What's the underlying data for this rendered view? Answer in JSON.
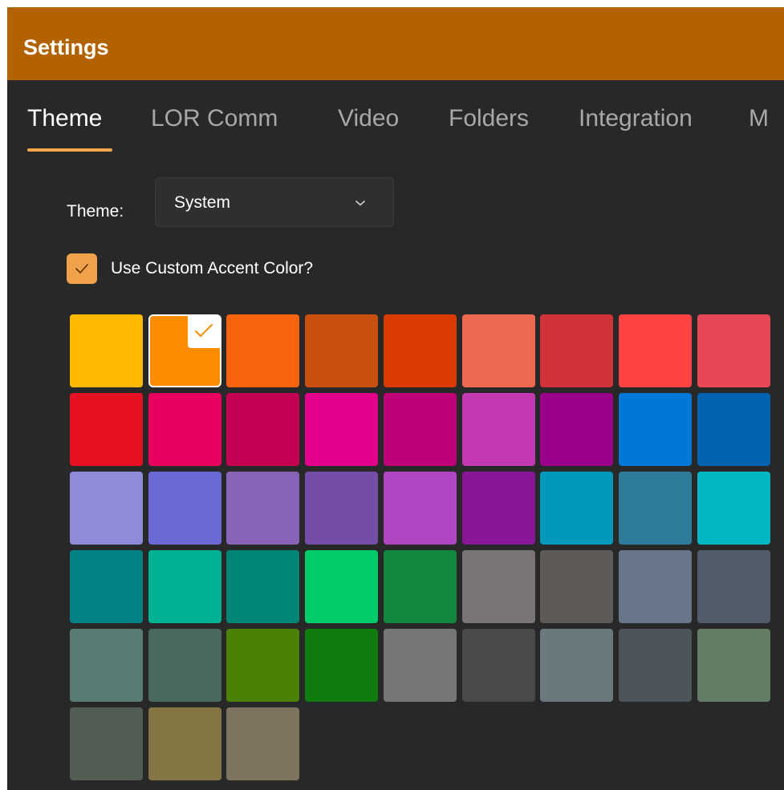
{
  "window": {
    "title": "Settings"
  },
  "tabs": [
    {
      "label": "Theme",
      "active": true
    },
    {
      "label": "LOR Comm",
      "active": false
    },
    {
      "label": "Video",
      "active": false
    },
    {
      "label": "Folders",
      "active": false
    },
    {
      "label": "Integration",
      "active": false
    },
    {
      "label": "M",
      "active": false
    }
  ],
  "theme_setting": {
    "label": "Theme:",
    "selected": "System",
    "icon": "chevron-down-icon"
  },
  "custom_accent": {
    "label": "Use Custom Accent Color?",
    "checked": true,
    "check_color": "#f0a34a"
  },
  "accent_colors": {
    "selected_index": 1,
    "rows": [
      [
        "#ffb900",
        "#ff8c00",
        "#f7630c",
        "#ca5010",
        "#da3b01",
        "#ef6950",
        "#d13438",
        "#ff4343",
        "#e74856"
      ],
      [
        "#e81123",
        "#ea005e",
        "#c30052",
        "#e3008c",
        "#bf0077",
        "#c239b3",
        "#9a0089",
        "#0078d7",
        "#0063b1"
      ],
      [
        "#8e8cd8",
        "#6b69d6",
        "#8764b8",
        "#744da9",
        "#b146c2",
        "#881798",
        "#0099bc",
        "#2d7d9a",
        "#00b7c3"
      ],
      [
        "#038387",
        "#00b294",
        "#018574",
        "#00cc6a",
        "#10893e",
        "#7a7574",
        "#5d5a58",
        "#68768a",
        "#515c6b"
      ],
      [
        "#567c73",
        "#486860",
        "#498205",
        "#107c10",
        "#767676",
        "#4c4a48",
        "#69797e",
        "#4a5459",
        "#647c64"
      ],
      [
        "#525e54",
        "#847545",
        "#7e735f"
      ]
    ]
  }
}
